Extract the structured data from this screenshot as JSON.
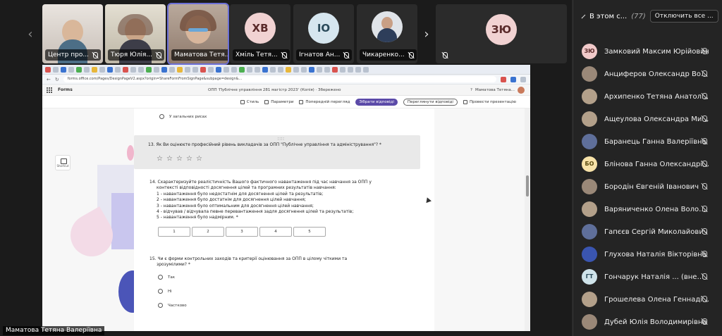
{
  "tiles": [
    {
      "name": "Центр про...",
      "type": "photo"
    },
    {
      "name": "Тюря Юлія...",
      "type": "photo"
    },
    {
      "name": "Маматова Тетя...",
      "type": "photo",
      "active": true
    },
    {
      "name": "Хміль Тетя...",
      "type": "initials",
      "initials": "ХВ"
    },
    {
      "name": "Ігнатов Ан...",
      "type": "initials",
      "initials": "ІО"
    },
    {
      "name": "Чикаренко...",
      "type": "photo"
    },
    {
      "name": "",
      "type": "initials",
      "initials": "ЗЮ"
    }
  ],
  "browser": {
    "url": "forms.office.com/Pages/DesignPageV2.aspx?origin=ShareFormFromSignPage&subpage=design&..."
  },
  "forms": {
    "app_name": "Forms",
    "form_title": "ОПП 'Публічне управління 281 магістр 2023' (Копія)  ·  Збережено",
    "user": "Маматова Тетяна..."
  },
  "toolbar": {
    "style": "Стиль",
    "settings": "Параметри",
    "preview": "Попередній перегляд",
    "collect": "Зібрати відповіді",
    "view_responses": "Переглянути відповіді",
    "present": "Провести презентацію"
  },
  "form": {
    "prev_option": "У загальних рисах",
    "q13": "13. Як Ви оцінюєте професійний рівень викладачів за ОПП \"Публічне управління та адміністрування\"? *",
    "q14_lines": [
      "14. Схарактеризуйте реалістичність Вашого фактичного навантаження під час навчання за ОПП у",
      "контексті відповідності досягнення цілей та програмних результатів навчання:",
      "1 - навантаження було недостатнім для досягнення цілей та результатів;",
      "2 - навантаження було достатнім для досягнення цілей навчання;",
      "3 - навантаження було оптимальним для досягнення цілей навчання;",
      "4 - відчував / відчувала певне перевантаження задля досягнення цілей та результатів;",
      "5 - навантаження було надмірним. *"
    ],
    "scale": [
      "1",
      "2",
      "3",
      "4",
      "5"
    ],
    "q15_lines": [
      "15. Чи є форми контрольних заходів та критерії оцінювання за ОПП в цілому чіткими та",
      "зрозумілими? *"
    ],
    "q15_options": [
      "Так",
      "Ні",
      "Частково"
    ],
    "side_button": "Shortcut"
  },
  "presenter": "Маматова Тетяна Валеріївна",
  "panel": {
    "title": "В этом с...",
    "count": "(77)",
    "mute_all": "Отключить все ...",
    "participants": [
      {
        "name": "Замковий Максим Юрійович",
        "initials": "ЗЮ"
      },
      {
        "name": "Анциферов Олександр Воло..."
      },
      {
        "name": "Архипенко Тетяна Анатоліївна"
      },
      {
        "name": "Ащеулова Олександра Мико..."
      },
      {
        "name": "Баранець Ганна Валеріївна"
      },
      {
        "name": "Блінова Ганна Олександрівна",
        "initials": "БО"
      },
      {
        "name": "Бородін Євгеній Іванович"
      },
      {
        "name": "Варяниченко Олена Володи..."
      },
      {
        "name": "Гапєєв Сергій Миколайович"
      },
      {
        "name": "Глухова Наталія Вікторівна"
      },
      {
        "name": "Гончарук Наталія ... (внешний)",
        "initials": "ГТ"
      },
      {
        "name": "Грошелева Олена Геннадіївна"
      },
      {
        "name": "Дубей Юлія Володимирівна"
      }
    ]
  }
}
